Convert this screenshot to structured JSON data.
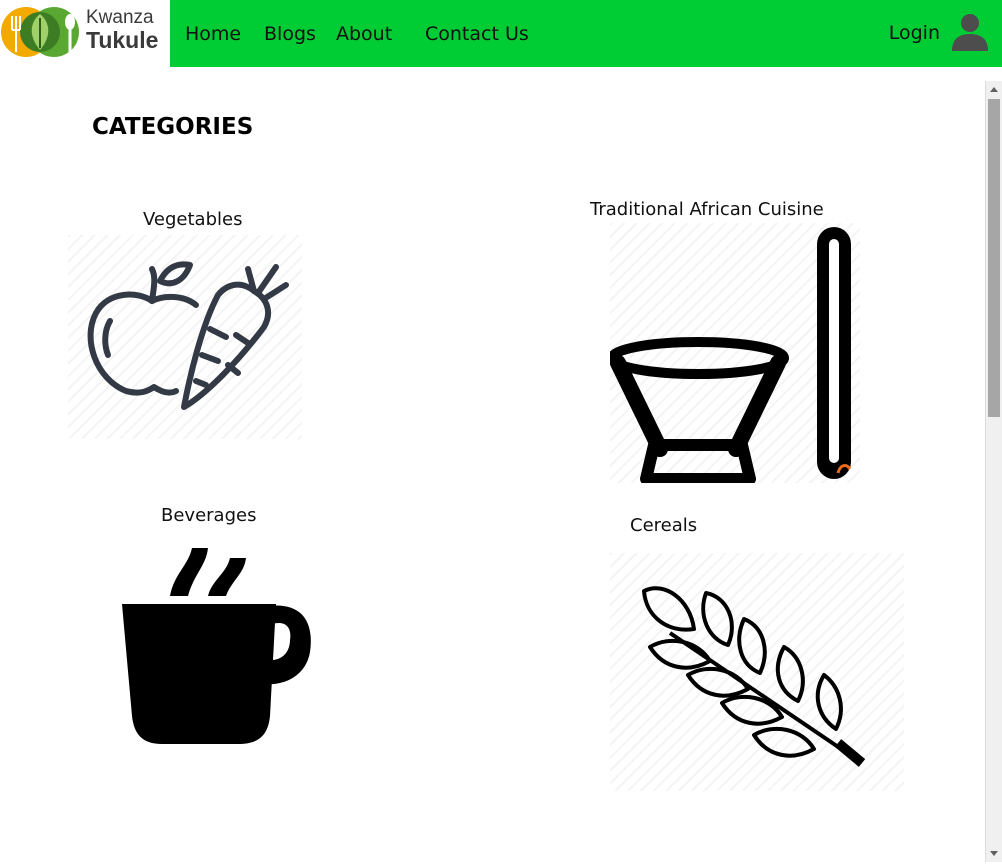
{
  "header": {
    "logo": {
      "line1": "Kwanza",
      "line2": "Tukule"
    },
    "nav": [
      "Home",
      "Blogs",
      "About",
      "Contact Us"
    ],
    "login_label": "Login"
  },
  "main": {
    "title": "CATEGORIES",
    "categories": [
      {
        "label": "Vegetables",
        "icon": "apple-carrot-icon"
      },
      {
        "label": "Traditional African Cuisine",
        "icon": "mortar-pestle-icon"
      },
      {
        "label": "Beverages",
        "icon": "coffee-mug-icon"
      },
      {
        "label": "Cereals",
        "icon": "wheat-icon"
      }
    ]
  },
  "colors": {
    "nav_bg": "#00cc33",
    "logo_orange": "#f2a900",
    "logo_green": "#5aa832",
    "icon_dark": "#333a45"
  }
}
